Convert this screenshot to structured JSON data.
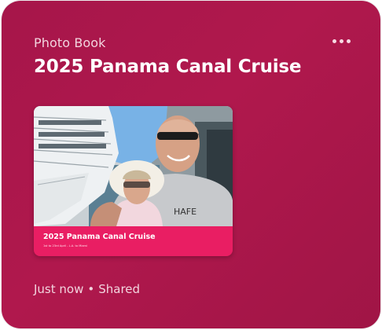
{
  "card": {
    "eyebrow": "Photo Book",
    "title": "2025 Panama Canal Cruise",
    "more_icon": "more-horizontal-icon",
    "accent_color": "#ac174b"
  },
  "thumbnail": {
    "cover_title": "2025 Panama Canal Cruise",
    "cover_subtitle": "1st to 23rd April - L.A. to Miami",
    "band_color": "#e91e63"
  },
  "meta": {
    "time": "Just now",
    "separator": "•",
    "status": "Shared"
  }
}
